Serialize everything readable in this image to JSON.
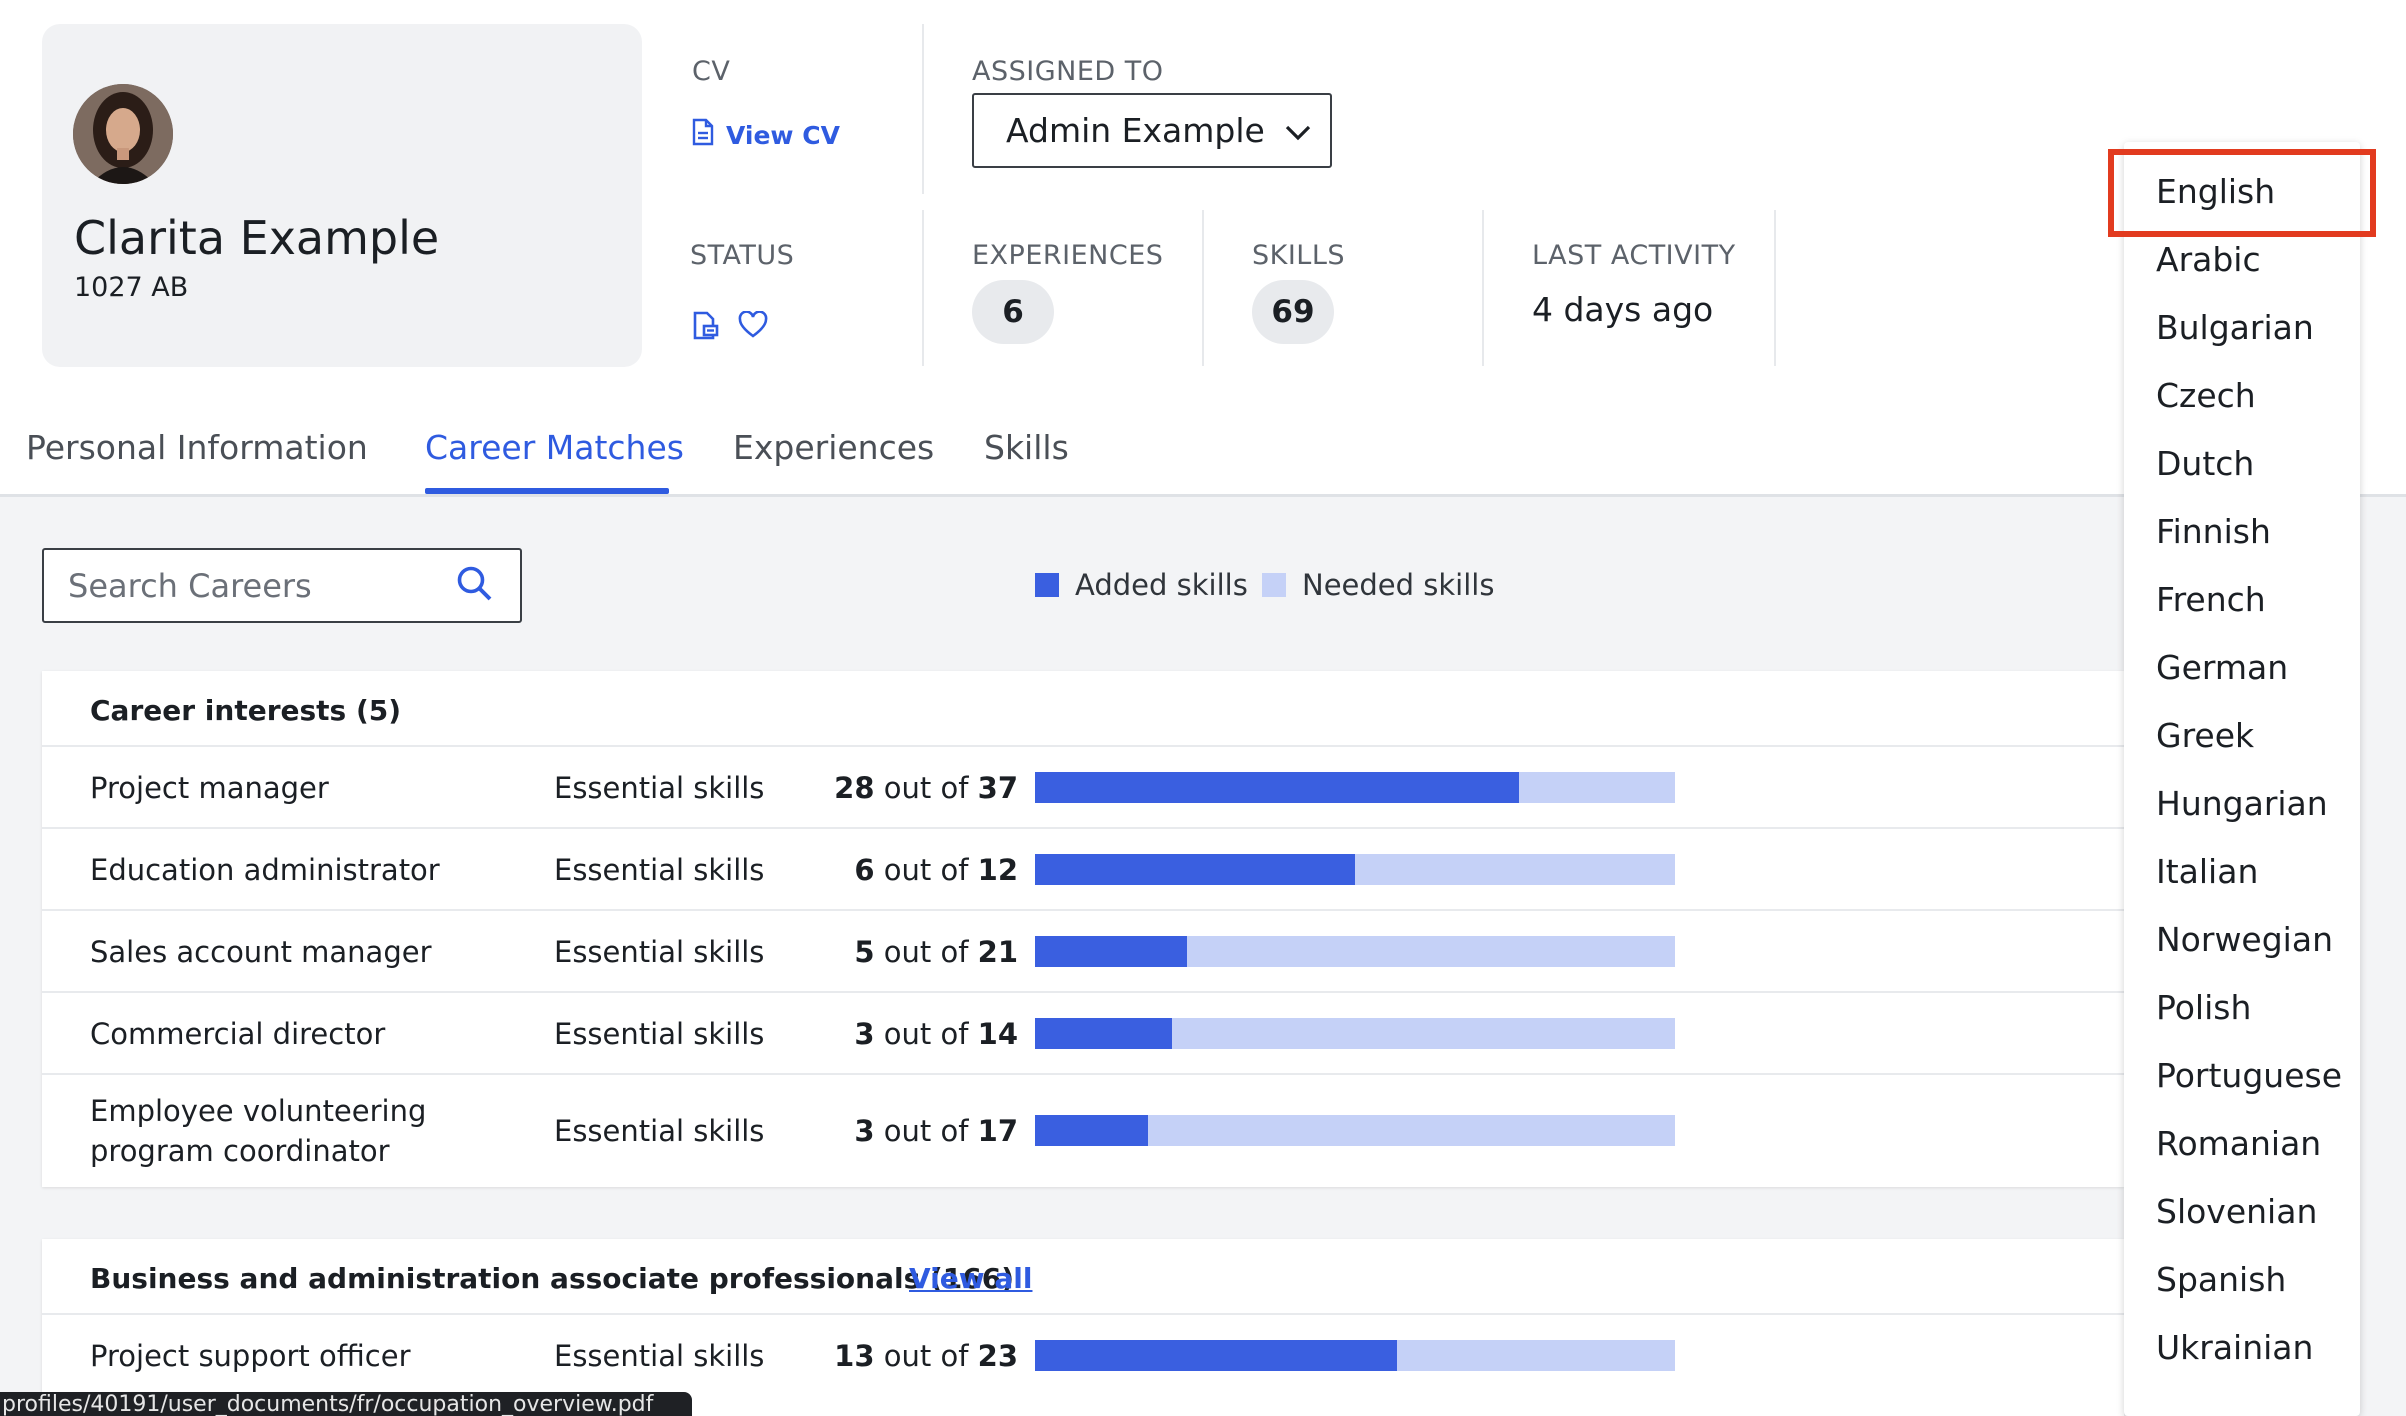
{
  "profile": {
    "name": "Clarita Example",
    "postcode": "1027 AB"
  },
  "cv": {
    "label": "CV",
    "link_label": "View CV"
  },
  "assigned": {
    "label": "ASSIGNED TO",
    "value": "Admin Example"
  },
  "status": {
    "label": "STATUS"
  },
  "experiences": {
    "label": "EXPERIENCES",
    "value": "6"
  },
  "skills": {
    "label": "SKILLS",
    "value": "69"
  },
  "last_activity": {
    "label": "LAST ACTIVITY",
    "value": "4 days ago"
  },
  "tabs": [
    {
      "label": "Personal Information"
    },
    {
      "label": "Career Matches"
    },
    {
      "label": "Experiences"
    },
    {
      "label": "Skills"
    }
  ],
  "search": {
    "placeholder": "Search Careers"
  },
  "legend": {
    "added": "Added skills",
    "needed": "Needed skills",
    "added_color": "#3a5fe0",
    "needed_color": "#c5d1f7"
  },
  "career_interests": {
    "title": "Career interests (5)",
    "rows": [
      {
        "name": "Project manager",
        "type": "Essential skills",
        "have": "28",
        "of_word": "out of",
        "total": "37",
        "fraction": 0.757
      },
      {
        "name": "Education administrator",
        "type": "Essential skills",
        "have": "6",
        "of_word": "out of",
        "total": "12",
        "fraction": 0.5
      },
      {
        "name": "Sales account manager",
        "type": "Essential skills",
        "have": "5",
        "of_word": "out of",
        "total": "21",
        "fraction": 0.238
      },
      {
        "name": "Commercial director",
        "type": "Essential skills",
        "have": "3",
        "of_word": "out of",
        "total": "14",
        "fraction": 0.214
      },
      {
        "name_line1": "Employee volunteering",
        "name_line2": "program coordinator",
        "type": "Essential skills",
        "have": "3",
        "of_word": "out of",
        "total": "17",
        "fraction": 0.176
      }
    ]
  },
  "business_group": {
    "title": "Business and administration associate professionals (166)",
    "view_all": "View all",
    "rows": [
      {
        "name": "Project support officer",
        "type": "Essential skills",
        "have": "13",
        "of_word": "out of",
        "total": "23",
        "fraction": 0.565
      }
    ]
  },
  "url_status": "profiles/40191/user_documents/fr/occupation_overview.pdf",
  "language_menu": {
    "selected": "English",
    "items": [
      "English",
      "Arabic",
      "Bulgarian",
      "Czech",
      "Dutch",
      "Finnish",
      "French",
      "German",
      "Greek",
      "Hungarian",
      "Italian",
      "Norwegian",
      "Polish",
      "Portuguese",
      "Romanian",
      "Slovenian",
      "Spanish",
      "Ukrainian"
    ]
  }
}
